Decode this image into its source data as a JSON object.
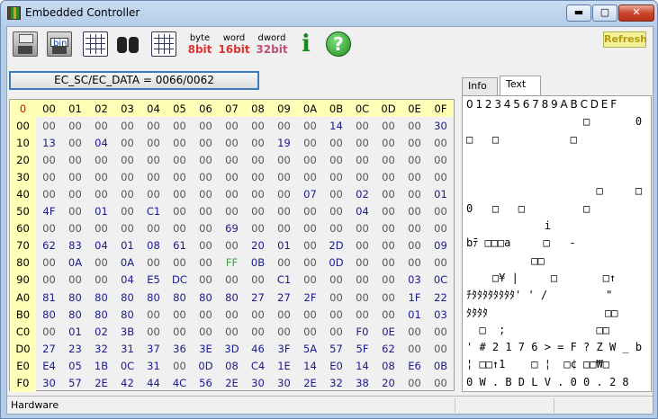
{
  "window": {
    "title": "Embedded Controller"
  },
  "toolbar": {
    "byte_top": "byte",
    "byte_bottom": "8bit",
    "word_top": "word",
    "word_bottom": "16bit",
    "dword_top": "dword",
    "dword_bottom": "32bit",
    "info_glyph": "i",
    "help_glyph": "?",
    "refresh_label": "Refresh",
    "icons": [
      "save-icon",
      "save-binary-icon",
      "open-icon",
      "find-icon",
      "table-icon",
      "info-icon",
      "help-icon"
    ]
  },
  "ec": {
    "label": "EC_SC/EC_DATA = 0066/0062"
  },
  "grid": {
    "corner": "0",
    "col_headers": [
      "00",
      "01",
      "02",
      "03",
      "04",
      "05",
      "06",
      "07",
      "08",
      "09",
      "0A",
      "0B",
      "0C",
      "0D",
      "0E",
      "0F"
    ],
    "rows": [
      {
        "h": "00",
        "c": [
          "00",
          "00",
          "00",
          "00",
          "00",
          "00",
          "00",
          "00",
          "00",
          "00",
          "00",
          "14",
          "00",
          "00",
          "00",
          "30"
        ]
      },
      {
        "h": "10",
        "c": [
          "13",
          "00",
          "04",
          "00",
          "00",
          "00",
          "00",
          "00",
          "00",
          "19",
          "00",
          "00",
          "00",
          "00",
          "00",
          "00"
        ]
      },
      {
        "h": "20",
        "c": [
          "00",
          "00",
          "00",
          "00",
          "00",
          "00",
          "00",
          "00",
          "00",
          "00",
          "00",
          "00",
          "00",
          "00",
          "00",
          "00"
        ]
      },
      {
        "h": "30",
        "c": [
          "00",
          "00",
          "00",
          "00",
          "00",
          "00",
          "00",
          "00",
          "00",
          "00",
          "00",
          "00",
          "00",
          "00",
          "00",
          "00"
        ]
      },
      {
        "h": "40",
        "c": [
          "00",
          "00",
          "00",
          "00",
          "00",
          "00",
          "00",
          "00",
          "00",
          "00",
          "07",
          "00",
          "02",
          "00",
          "00",
          "01"
        ]
      },
      {
        "h": "50",
        "c": [
          "4F",
          "00",
          "01",
          "00",
          "C1",
          "00",
          "00",
          "00",
          "00",
          "00",
          "00",
          "00",
          "04",
          "00",
          "00",
          "00"
        ]
      },
      {
        "h": "60",
        "c": [
          "00",
          "00",
          "00",
          "00",
          "00",
          "00",
          "00",
          "69",
          "00",
          "00",
          "00",
          "00",
          "00",
          "00",
          "00",
          "00"
        ]
      },
      {
        "h": "70",
        "c": [
          "62",
          "83",
          "04",
          "01",
          "08",
          "61",
          "00",
          "00",
          "20",
          "01",
          "00",
          "2D",
          "00",
          "00",
          "00",
          "09"
        ]
      },
      {
        "h": "80",
        "c": [
          "00",
          "0A",
          "00",
          "0A",
          "00",
          "00",
          "00",
          "FF",
          "0B",
          "00",
          "00",
          "0D",
          "00",
          "00",
          "00",
          "00"
        ]
      },
      {
        "h": "90",
        "c": [
          "00",
          "00",
          "00",
          "04",
          "E5",
          "DC",
          "00",
          "00",
          "00",
          "C1",
          "00",
          "00",
          "00",
          "00",
          "03",
          "0C"
        ]
      },
      {
        "h": "A0",
        "c": [
          "81",
          "80",
          "80",
          "80",
          "80",
          "80",
          "80",
          "80",
          "27",
          "27",
          "2F",
          "00",
          "00",
          "00",
          "1F",
          "22"
        ]
      },
      {
        "h": "B0",
        "c": [
          "80",
          "80",
          "80",
          "80",
          "00",
          "00",
          "00",
          "00",
          "00",
          "00",
          "00",
          "00",
          "00",
          "00",
          "01",
          "03"
        ]
      },
      {
        "h": "C0",
        "c": [
          "00",
          "01",
          "02",
          "3B",
          "00",
          "00",
          "00",
          "00",
          "00",
          "00",
          "00",
          "00",
          "F0",
          "0E",
          "00",
          "00"
        ]
      },
      {
        "h": "D0",
        "c": [
          "27",
          "23",
          "32",
          "31",
          "37",
          "36",
          "3E",
          "3D",
          "46",
          "3F",
          "5A",
          "57",
          "5F",
          "62",
          "00",
          "00"
        ]
      },
      {
        "h": "E0",
        "c": [
          "E4",
          "05",
          "1B",
          "0C",
          "31",
          "00",
          "0D",
          "08",
          "C4",
          "1E",
          "14",
          "E0",
          "14",
          "08",
          "E6",
          "0B"
        ]
      },
      {
        "h": "F0",
        "c": [
          "30",
          "57",
          "2E",
          "42",
          "44",
          "4C",
          "56",
          "2E",
          "30",
          "30",
          "2E",
          "32",
          "38",
          "20",
          "00",
          "00"
        ]
      }
    ],
    "highlight_value": "FF"
  },
  "tabs": {
    "info": "Info",
    "text": "Text"
  },
  "text_panel": {
    "header": "0 1 2 3 4 5 6 7 8 9 A B C D E F",
    "lines": [
      "                  □       0",
      "□   □           □         ",
      "                          ",
      "                          ",
      "                    □     □",
      "0   □   □         □       ",
      "            i              ",
      "bﾃ □□□a     □   -         ",
      "          □□              ",
      "    □¥ |     □       □↑   ",
      "ﾁﾀﾀﾀﾀﾀﾀﾀﾀ' ' /         \"",
      "ﾀﾀﾀﾀ                  □□",
      "  □  ;              □□    ",
      "' # 2 1 7 6 > = F ? Z W _ b",
      "¦ □□↑1    □ ¦  □¢ □□₩□",
      "0 W . B D L V . 0 0 . 2 8  "
    ]
  },
  "status": {
    "segments": [
      "Hardware",
      "",
      ""
    ]
  }
}
